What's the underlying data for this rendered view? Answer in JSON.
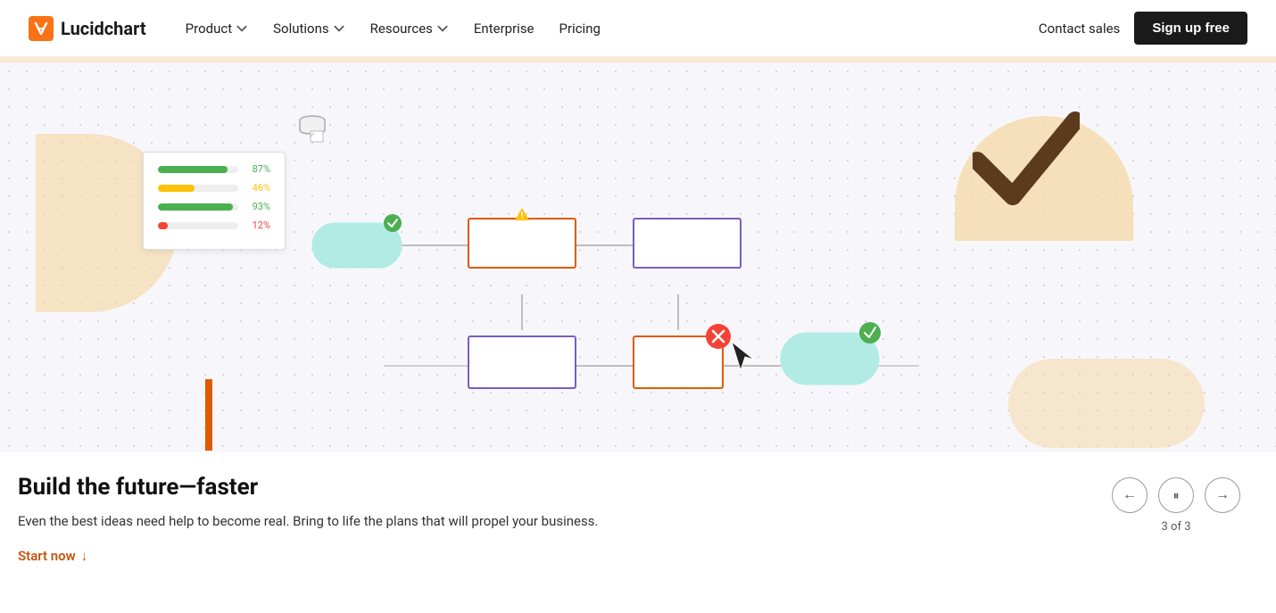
{
  "nav": {
    "logo_text": "Lucidchart",
    "links": [
      {
        "label": "Product",
        "has_dropdown": true
      },
      {
        "label": "Solutions",
        "has_dropdown": true
      },
      {
        "label": "Resources",
        "has_dropdown": true
      },
      {
        "label": "Enterprise",
        "has_dropdown": false
      },
      {
        "label": "Pricing",
        "has_dropdown": false
      }
    ],
    "contact_sales": "Contact sales",
    "sign_up": "Sign up free"
  },
  "hero": {
    "title": "Build the future—faster",
    "description": "Even the best ideas need help to become real. Bring to life the plans that will propel your business.",
    "cta": "Start now"
  },
  "controls": {
    "prev_label": "←",
    "pause_label": "⏸",
    "next_label": "→",
    "page_indicator": "3 of 3"
  },
  "chart": {
    "rows": [
      {
        "color": "#4caf50",
        "pct": 87,
        "label": "87%"
      },
      {
        "color": "#ffc107",
        "pct": 46,
        "label": "46%"
      },
      {
        "color": "#4caf50",
        "pct": 93,
        "label": "93%"
      },
      {
        "color": "#f44336",
        "pct": 12,
        "label": "12%"
      }
    ]
  },
  "colors": {
    "accent_orange": "#c8540a",
    "nav_bg": "#fff",
    "dot_bg": "#f7f7fb",
    "deco_yellow": "#f5d5a0"
  }
}
